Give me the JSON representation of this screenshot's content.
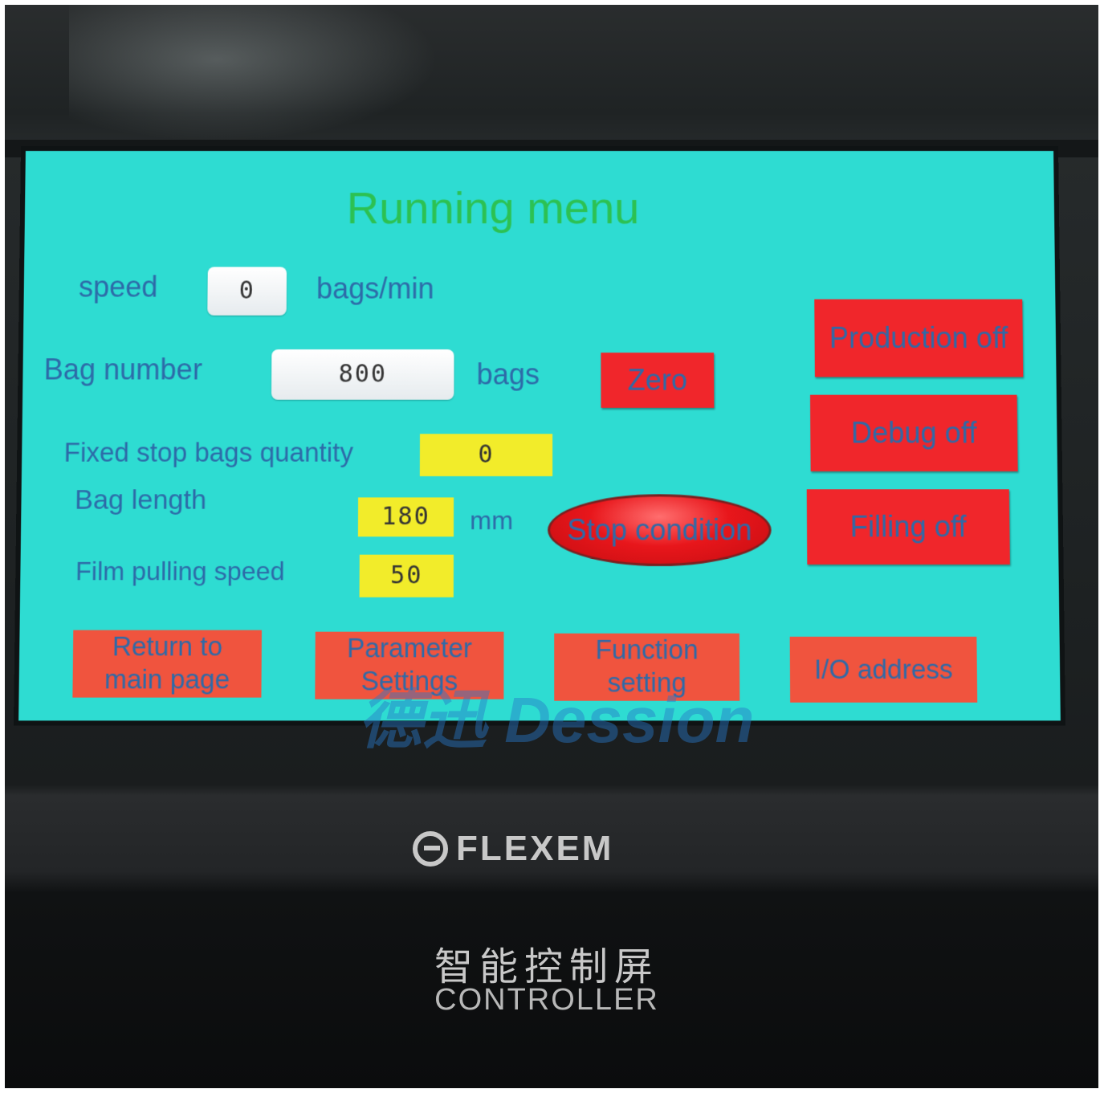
{
  "screen": {
    "title": "Running menu",
    "speed": {
      "label": "speed",
      "value": "0",
      "unit": "bags/min"
    },
    "bag_number": {
      "label": "Bag number",
      "value": "800",
      "unit": "bags"
    },
    "fixed_stop": {
      "label": "Fixed stop bags quantity",
      "value": "0"
    },
    "bag_length": {
      "label": "Bag length",
      "value": "180",
      "unit": "mm"
    },
    "film_pulling_speed": {
      "label": "Film pulling speed",
      "value": "50"
    },
    "buttons": {
      "zero": "Zero",
      "stop_condition": "Stop condition",
      "production": "Production off",
      "debug": "Debug off",
      "filling": "Filling off"
    },
    "nav": {
      "return_line1": "Return to",
      "return_line2": "main page",
      "param_line1": "Parameter",
      "param_line2": "Settings",
      "func_line1": "Function",
      "func_line2": "setting",
      "io": "I/O address"
    },
    "colors": {
      "screen_bg": "#2edcd2",
      "title": "#2cc152",
      "label_text": "#2d6aa8",
      "button_red": "#f0262b",
      "button_orange": "#f0543e",
      "input_yellow": "#f2ec2a"
    }
  },
  "watermark": "德迅 Dession",
  "hardware": {
    "brand": "FLEXEM",
    "brand_icon": "flexem-logo-icon",
    "label_cn": "智能控制屏",
    "label_en": "CONTROLLER"
  }
}
